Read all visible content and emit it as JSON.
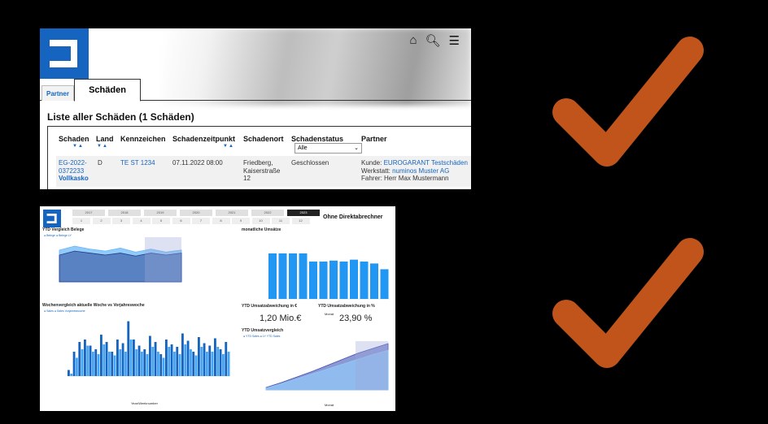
{
  "top_panel": {
    "topbar": {
      "icons": [
        "home-icon",
        "search-icon",
        "menu-icon"
      ]
    },
    "tabs": {
      "partner": "Partner",
      "schaeden": "Schäden"
    },
    "list_title": "Liste aller Schäden (1 Schäden)",
    "columns": [
      "Schaden",
      "Land",
      "Kennzeichen",
      "Schadenzeitpunkt",
      "Schadenort",
      "Schadenstatus",
      "Partner"
    ],
    "status_filter": "Alle",
    "row": {
      "schaden_1": "EG-2022-",
      "schaden_2": "0372233",
      "schaden_type": "Vollkasko",
      "land": "D",
      "kennzeichen": "TE ST 1234",
      "zeitpunkt": "07.11.2022 08:00",
      "ort_1": "Friedberg,",
      "ort_2": "Kaiserstraße",
      "ort_3": "12",
      "status": "Geschlossen",
      "kunde_label": "Kunde:",
      "kunde": "EUROGARANT Testschäden",
      "werkstatt_label": "Werkstatt:",
      "werkstatt": "numinos Muster AG",
      "fahrer": "Fahrer: Herr Max Mustermann"
    }
  },
  "dashboard": {
    "years": [
      "2017",
      "2018",
      "2019",
      "2020",
      "2021",
      "2022",
      "2023"
    ],
    "selected_year": "2023",
    "months": [
      "1",
      "2",
      "3",
      "4",
      "5",
      "6",
      "7",
      "8",
      "9",
      "10",
      "11",
      "12"
    ],
    "filter_label": "Ohne Direktabrechner",
    "ytd_belege_title": "YTD Vergleich Belege",
    "ytd_belege_legend": [
      "Belege",
      "Belege LY"
    ],
    "monthly_title": "monatliche Umsätze",
    "monthly_xlabel": "Monat",
    "weekly_title": "Wochenvergleich aktuelle Woche vs Vorjahreswoche",
    "weekly_legend": [
      "Sales",
      "Sales Vorjahreswoche"
    ],
    "weekly_xlabel": "Year/Weeknumber",
    "kpi1_title": "YTD Umsatzabweichung in €",
    "kpi1_value": "1,20 Mio.€",
    "kpi2_title": "YTD Umsatzabweichung in %",
    "kpi2_value": "23,90 %",
    "ytd_umsatz_title": "YTD Umsatzvergleich",
    "ytd_umsatz_legend": [
      "YTD Sales",
      "LY YTD Sales"
    ],
    "ytd_umsatz_xlabel": "Monat"
  },
  "checkmark_color": "#c1541b",
  "chart_data": [
    {
      "type": "bar",
      "title": "monatliche Umsätze",
      "xlabel": "Monat",
      "values": [
        0.95,
        0.95,
        0.95,
        0.95,
        0.78,
        0.78,
        0.8,
        0.78,
        0.82,
        0.78,
        0.74,
        0.62
      ]
    },
    {
      "type": "area",
      "title": "YTD Vergleich Belege",
      "series": [
        {
          "name": "Belege",
          "values": [
            3.2,
            3.6,
            3.3,
            3.1,
            3.4,
            3.0,
            3.3,
            3.0,
            3.2
          ]
        },
        {
          "name": "Belege LY",
          "values": [
            2.7,
            3.1,
            2.9,
            2.7,
            2.9,
            2.6,
            2.9,
            2.7,
            2.9
          ]
        }
      ]
    },
    {
      "type": "area",
      "title": "YTD Umsatzvergleich",
      "xlabel": "Monat",
      "series": [
        {
          "name": "YTD Sales",
          "values": [
            0.3,
            1.0,
            1.8,
            2.6,
            3.4,
            4.2,
            5.0,
            5.8,
            6.5
          ]
        },
        {
          "name": "LY YTD Sales",
          "values": [
            0.4,
            1.2,
            2.1,
            3.0,
            4.0,
            5.0,
            6.0,
            6.8,
            7.6
          ]
        }
      ]
    },
    {
      "type": "bar",
      "title": "Wochenvergleich aktuelle Woche vs Vorjahreswoche",
      "xlabel": "Year/Weeknumber",
      "series": [
        {
          "name": "Sales",
          "values": [
            0.05,
            0.2,
            0.28,
            0.3,
            0.25,
            0.22,
            0.34,
            0.28,
            0.2,
            0.3,
            0.27,
            0.45,
            0.3,
            0.25,
            0.22,
            0.33,
            0.28,
            0.18,
            0.3,
            0.26,
            0.24,
            0.35,
            0.29,
            0.2,
            0.32,
            0.27,
            0.25,
            0.31,
            0.22,
            0.28
          ]
        },
        {
          "name": "Sales Vorjahreswoche",
          "values": [
            0.02,
            0.15,
            0.22,
            0.25,
            0.2,
            0.18,
            0.26,
            0.2,
            0.17,
            0.22,
            0.2,
            0.3,
            0.22,
            0.2,
            0.18,
            0.24,
            0.2,
            0.15,
            0.24,
            0.2,
            0.18,
            0.26,
            0.22,
            0.17,
            0.24,
            0.2,
            0.2,
            0.24,
            0.18,
            0.2
          ]
        }
      ]
    }
  ]
}
